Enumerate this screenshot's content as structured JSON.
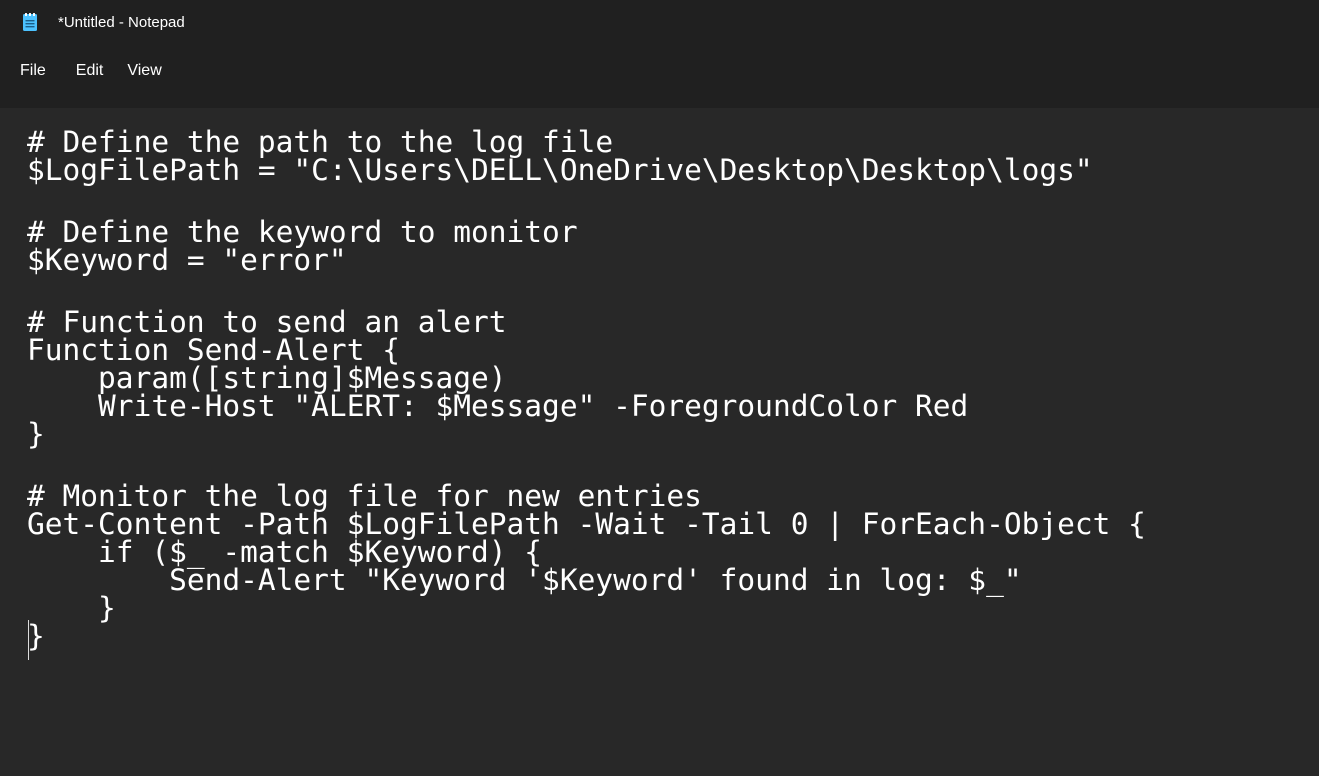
{
  "window": {
    "title": "*Untitled - Notepad",
    "icon": "notepad-icon"
  },
  "menu": {
    "file": "File",
    "edit": "Edit",
    "view": "View"
  },
  "editor": {
    "lines": [
      "# Define the path to the log file",
      "$LogFilePath = \"C:\\Users\\DELL\\OneDrive\\Desktop\\Desktop\\logs\"",
      "",
      "# Define the keyword to monitor",
      "$Keyword = \"error\"",
      "",
      "# Function to send an alert",
      "Function Send-Alert {",
      "    param([string]$Message)",
      "    Write-Host \"ALERT: $Message\" -ForegroundColor Red",
      "}",
      "",
      "# Monitor the log file for new entries",
      "Get-Content -Path $LogFilePath -Wait -Tail 0 | ForEach-Object {",
      "    if ($_ -match $Keyword) {",
      "        Send-Alert \"Keyword '$Keyword' found in log: $_\"",
      "    }",
      "}"
    ]
  },
  "colors": {
    "titlebar_bg": "#202020",
    "editor_bg": "#282828",
    "text": "#ffffff",
    "icon_accent": "#4cc2ff"
  }
}
